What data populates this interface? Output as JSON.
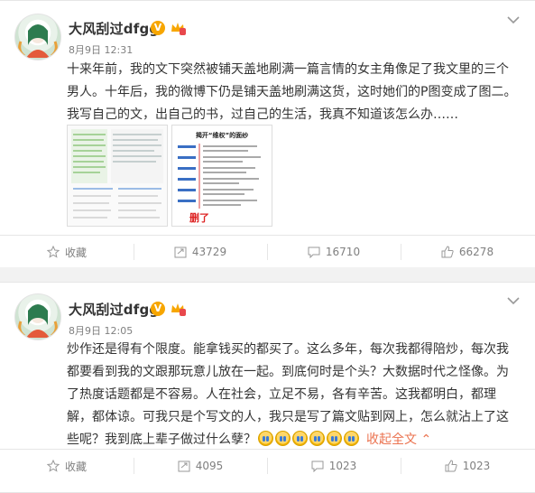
{
  "posts": [
    {
      "username": "大风刮过dfgg",
      "verified_badge": "V",
      "date": "8月9日 12:31",
      "text": "十来年前，我的文下突然被铺天盖地刷满一篇言情的女主角像足了我文里的三个男人。十年后，我的微博下仍是铺天盖地刷满这货，这时她们的P图变成了图二。我写自己的文，出自己的书，过自己的生活，我真不知道该怎么办……",
      "images": [
        {
          "icon": "screenshot-comparison-image"
        },
        {
          "title": "揭开“维权”的面纱",
          "stamp": "删了",
          "icon": "timeline-infographic-image"
        }
      ],
      "actions": {
        "collect_label": "收藏",
        "repost_count": "43729",
        "comment_count": "16710",
        "like_count": "66278"
      }
    },
    {
      "username": "大风刮过dfgg",
      "verified_badge": "V",
      "date": "8月9日 12:05",
      "text": "炒作还是得有个限度。能拿钱买的都买了。这么多年，每次我都得陪炒，每次我都要看到我的文跟那玩意儿放在一起。到底何时是个头？大数据时代之怪像。为了热度话题都是不容易。人在社会，立足不易，各有辛苦。这我都明白，都理解，都体谅。可我只是个写文的人，我只是写了篇文贴到网上，怎么就沾上了这些呢？我到底上辈子做过什么孽？",
      "emoji": [
        "crying-emoji",
        "crying-emoji",
        "crying-emoji",
        "crying-emoji",
        "crying-emoji",
        "crying-emoji"
      ],
      "collapse_label": "收起全文",
      "actions": {
        "collect_label": "收藏",
        "repost_count": "4095",
        "comment_count": "1023",
        "like_count": "1023"
      }
    }
  ],
  "colors": {
    "accent_link": "#eb7350",
    "vip_badge": "#f7a600",
    "muted_text": "#808080"
  }
}
